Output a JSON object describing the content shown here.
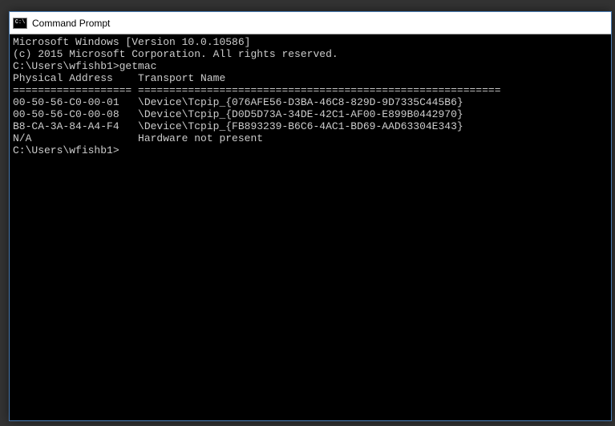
{
  "window": {
    "title": "Command Prompt",
    "icon_text": "C:\\"
  },
  "terminal": {
    "line1": "Microsoft Windows [Version 10.0.10586]",
    "line2": "(c) 2015 Microsoft Corporation. All rights reserved.",
    "blank1": "",
    "prompt1_path": "C:\\Users\\wfishb1>",
    "prompt1_cmd": "getmac",
    "blank2": "",
    "header": "Physical Address    Transport Name",
    "divider": "=================== ==========================================================",
    "row1": "00-50-56-C0-00-01   \\Device\\Tcpip_{076AFE56-D3BA-46C8-829D-9D7335C445B6}",
    "row2": "00-50-56-C0-00-08   \\Device\\Tcpip_{D0D5D73A-34DE-42C1-AF00-E899B0442970}",
    "row3": "B8-CA-3A-84-A4-F4   \\Device\\Tcpip_{FB893239-B6C6-4AC1-BD69-AAD63304E343}",
    "row4": "N/A                 Hardware not present",
    "blank3": "",
    "prompt2_path": "C:\\Users\\wfishb1>"
  }
}
